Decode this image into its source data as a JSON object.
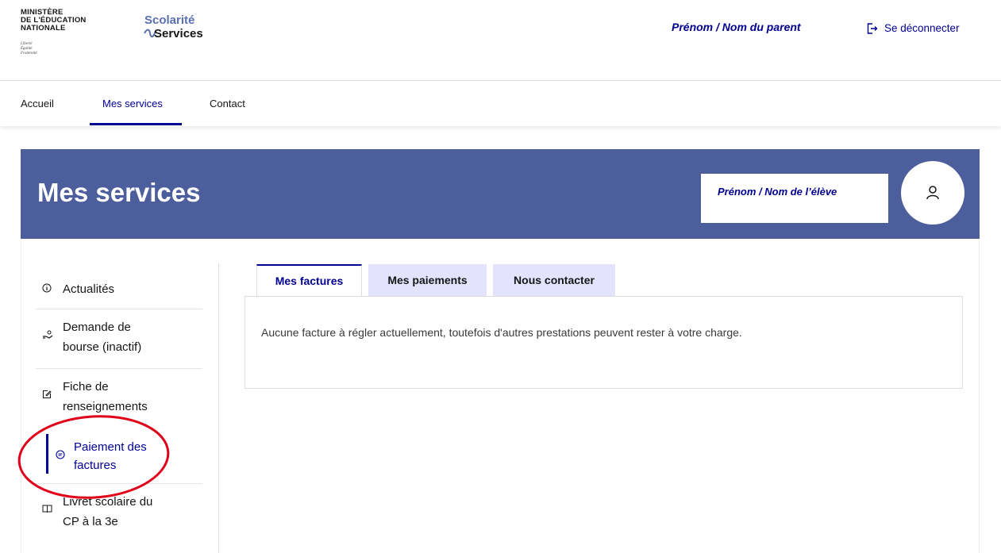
{
  "header": {
    "ministere_lines": [
      "MINISTÈRE",
      "DE L'ÉDUCATION",
      "NATIONALE"
    ],
    "devise": [
      "Liberté",
      "Égalité",
      "Fraternité"
    ],
    "brand_top": "Scolarité",
    "brand_bottom": "Services",
    "parent_name": "Prénom / Nom du parent",
    "logout_label": "Se déconnecter",
    "accent_color": "#000091"
  },
  "nav": {
    "items": [
      {
        "label": "Accueil"
      },
      {
        "label": "Mes services",
        "active": true
      },
      {
        "label": "Contact"
      }
    ]
  },
  "banner": {
    "title": "Mes services",
    "student_name": "Prénom / Nom de l’élève",
    "avatar_icon": "user-icon",
    "background_color": "#4c5e9c"
  },
  "sidebar": {
    "items": [
      {
        "icon": "info-icon",
        "lines": [
          "Actualités"
        ]
      },
      {
        "icon": "scholarship-icon",
        "lines": [
          "Demande de",
          "bourse (inactif)"
        ]
      },
      {
        "icon": "edit-form-icon",
        "lines": [
          "Fiche de",
          "renseignements"
        ]
      },
      {
        "icon": "payment-icon",
        "lines": [
          "Paiement des",
          "factures"
        ],
        "active": true
      },
      {
        "icon": "book-icon",
        "lines": [
          "Livret scolaire du",
          "CP à la 3e"
        ]
      }
    ]
  },
  "tabs": {
    "items": [
      {
        "label": "Mes factures",
        "active": true
      },
      {
        "label": "Mes paiements"
      },
      {
        "label": "Nous contacter"
      }
    ],
    "panel_text": "Aucune facture à régler actuellement, toutefois d'autres prestations peuvent rester à votre charge."
  },
  "annotation": {
    "shape": "ellipse",
    "color": "#e0001a"
  }
}
